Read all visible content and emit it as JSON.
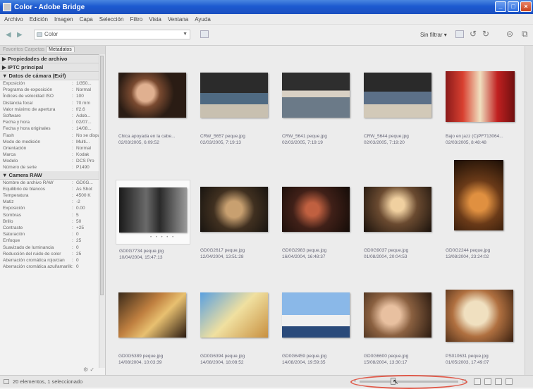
{
  "window": {
    "title": "Color - Adobe Bridge"
  },
  "menu": [
    "Archivo",
    "Edición",
    "Imagen",
    "Capa",
    "Selección",
    "Filtro",
    "Vista",
    "Ventana",
    "Ayuda"
  ],
  "toolbar": {
    "path": "Color",
    "filter": "Sin filtrar ▾"
  },
  "panel": {
    "tabs": [
      "Favoritos",
      "Carpetas",
      "Metadatos"
    ],
    "sections": [
      {
        "title": "▶ Propiedades de archivo",
        "rows": []
      },
      {
        "title": "▶ IPTC principal",
        "rows": []
      },
      {
        "title": "▼ Datos de cámara (Exif)",
        "rows": [
          [
            "Exposición",
            "1/350..."
          ],
          [
            "Programa de exposición",
            "Normal"
          ],
          [
            "Índices de velocidad ISO",
            "100"
          ],
          [
            "Distancia focal",
            "70 mm"
          ],
          [
            "Valor máximo de apertura",
            "f/2.6"
          ],
          [
            "Software",
            "Adob..."
          ],
          [
            "Fecha y hora",
            "02/07..."
          ],
          [
            "Fecha y hora originales",
            "14/08..."
          ],
          [
            "Flash",
            "No se disparó"
          ],
          [
            "Modo de medición",
            "Multi..."
          ],
          [
            "Orientación",
            "Normal"
          ],
          [
            "Marca",
            "Kodak"
          ],
          [
            "Modelo",
            "DCS Pro"
          ],
          [
            "Número de serie",
            "P1490"
          ]
        ]
      },
      {
        "title": "▼ Camera RAW",
        "rows": [
          [
            "Nombre de archivo RAW",
            "GD0G..."
          ],
          [
            "Equilibrio de blancos",
            "As Shot"
          ],
          [
            "Temperatura",
            "4500 K"
          ],
          [
            "Matiz",
            "-2"
          ],
          [
            "Exposición",
            "0.00"
          ],
          [
            "Sombras",
            "5"
          ],
          [
            "Brillo",
            "50"
          ],
          [
            "Contraste",
            "+25"
          ],
          [
            "Saturación",
            "0"
          ],
          [
            "Enfoque",
            "25"
          ],
          [
            "Suavizado de luminancia",
            "0"
          ],
          [
            "Reducción del ruido de color",
            "25"
          ],
          [
            "Aberración cromática rojo/cian",
            "0"
          ],
          [
            "Aberración cromática azul/amarillo",
            "0"
          ]
        ]
      }
    ]
  },
  "thumbnails": [
    {
      "name": "Chica apoyada en la cabe...",
      "date": "02/03/2005, 6:09:52"
    },
    {
      "name": "CRW_5657 peque.jpg",
      "date": "02/03/2005, 7:19:13"
    },
    {
      "name": "CRW_5641 peque.jpg",
      "date": "02/03/2005, 7:19:19"
    },
    {
      "name": "CRW_5644 peque.jpg",
      "date": "02/03/2005, 7:19:20"
    },
    {
      "name": "Bajo en jazz (C)PF713064...",
      "date": "02/03/2005, 8:48:48"
    },
    {
      "name": "GD0G7734 peque.jpg",
      "date": "10/04/2004, 15:47:13"
    },
    {
      "name": "GD0G2617 peque.jpg",
      "date": "12/04/2004, 13:51:28"
    },
    {
      "name": "GD0G2983 peque.jpg",
      "date": "16/04/2004, 16:48:37"
    },
    {
      "name": "GD0G9037 peque.jpg",
      "date": "01/08/2004, 20:04:53"
    },
    {
      "name": "GD0G2244 peque.jpg",
      "date": "13/08/2004, 23:24:02"
    },
    {
      "name": "GD0G5389 peque.jpg",
      "date": "14/08/2004, 10:03:39"
    },
    {
      "name": "GD0G6394 peque.jpg",
      "date": "14/08/2004, 18:08:52"
    },
    {
      "name": "GD0G6459 peque.jpg",
      "date": "14/08/2004, 19:59:35"
    },
    {
      "name": "GD0G6600 peque.jpg",
      "date": "15/08/2004, 13:30:17"
    },
    {
      "name": "PS010631 peque.jpg",
      "date": "01/05/2003, 17:49:07"
    }
  ],
  "selected_stars": "• • • • •",
  "status": {
    "text": "20 elementos, 1 seleccionado"
  },
  "colors": {
    "titlebar": "#1d5ad0",
    "highlight_circle": "#e05a4a"
  }
}
